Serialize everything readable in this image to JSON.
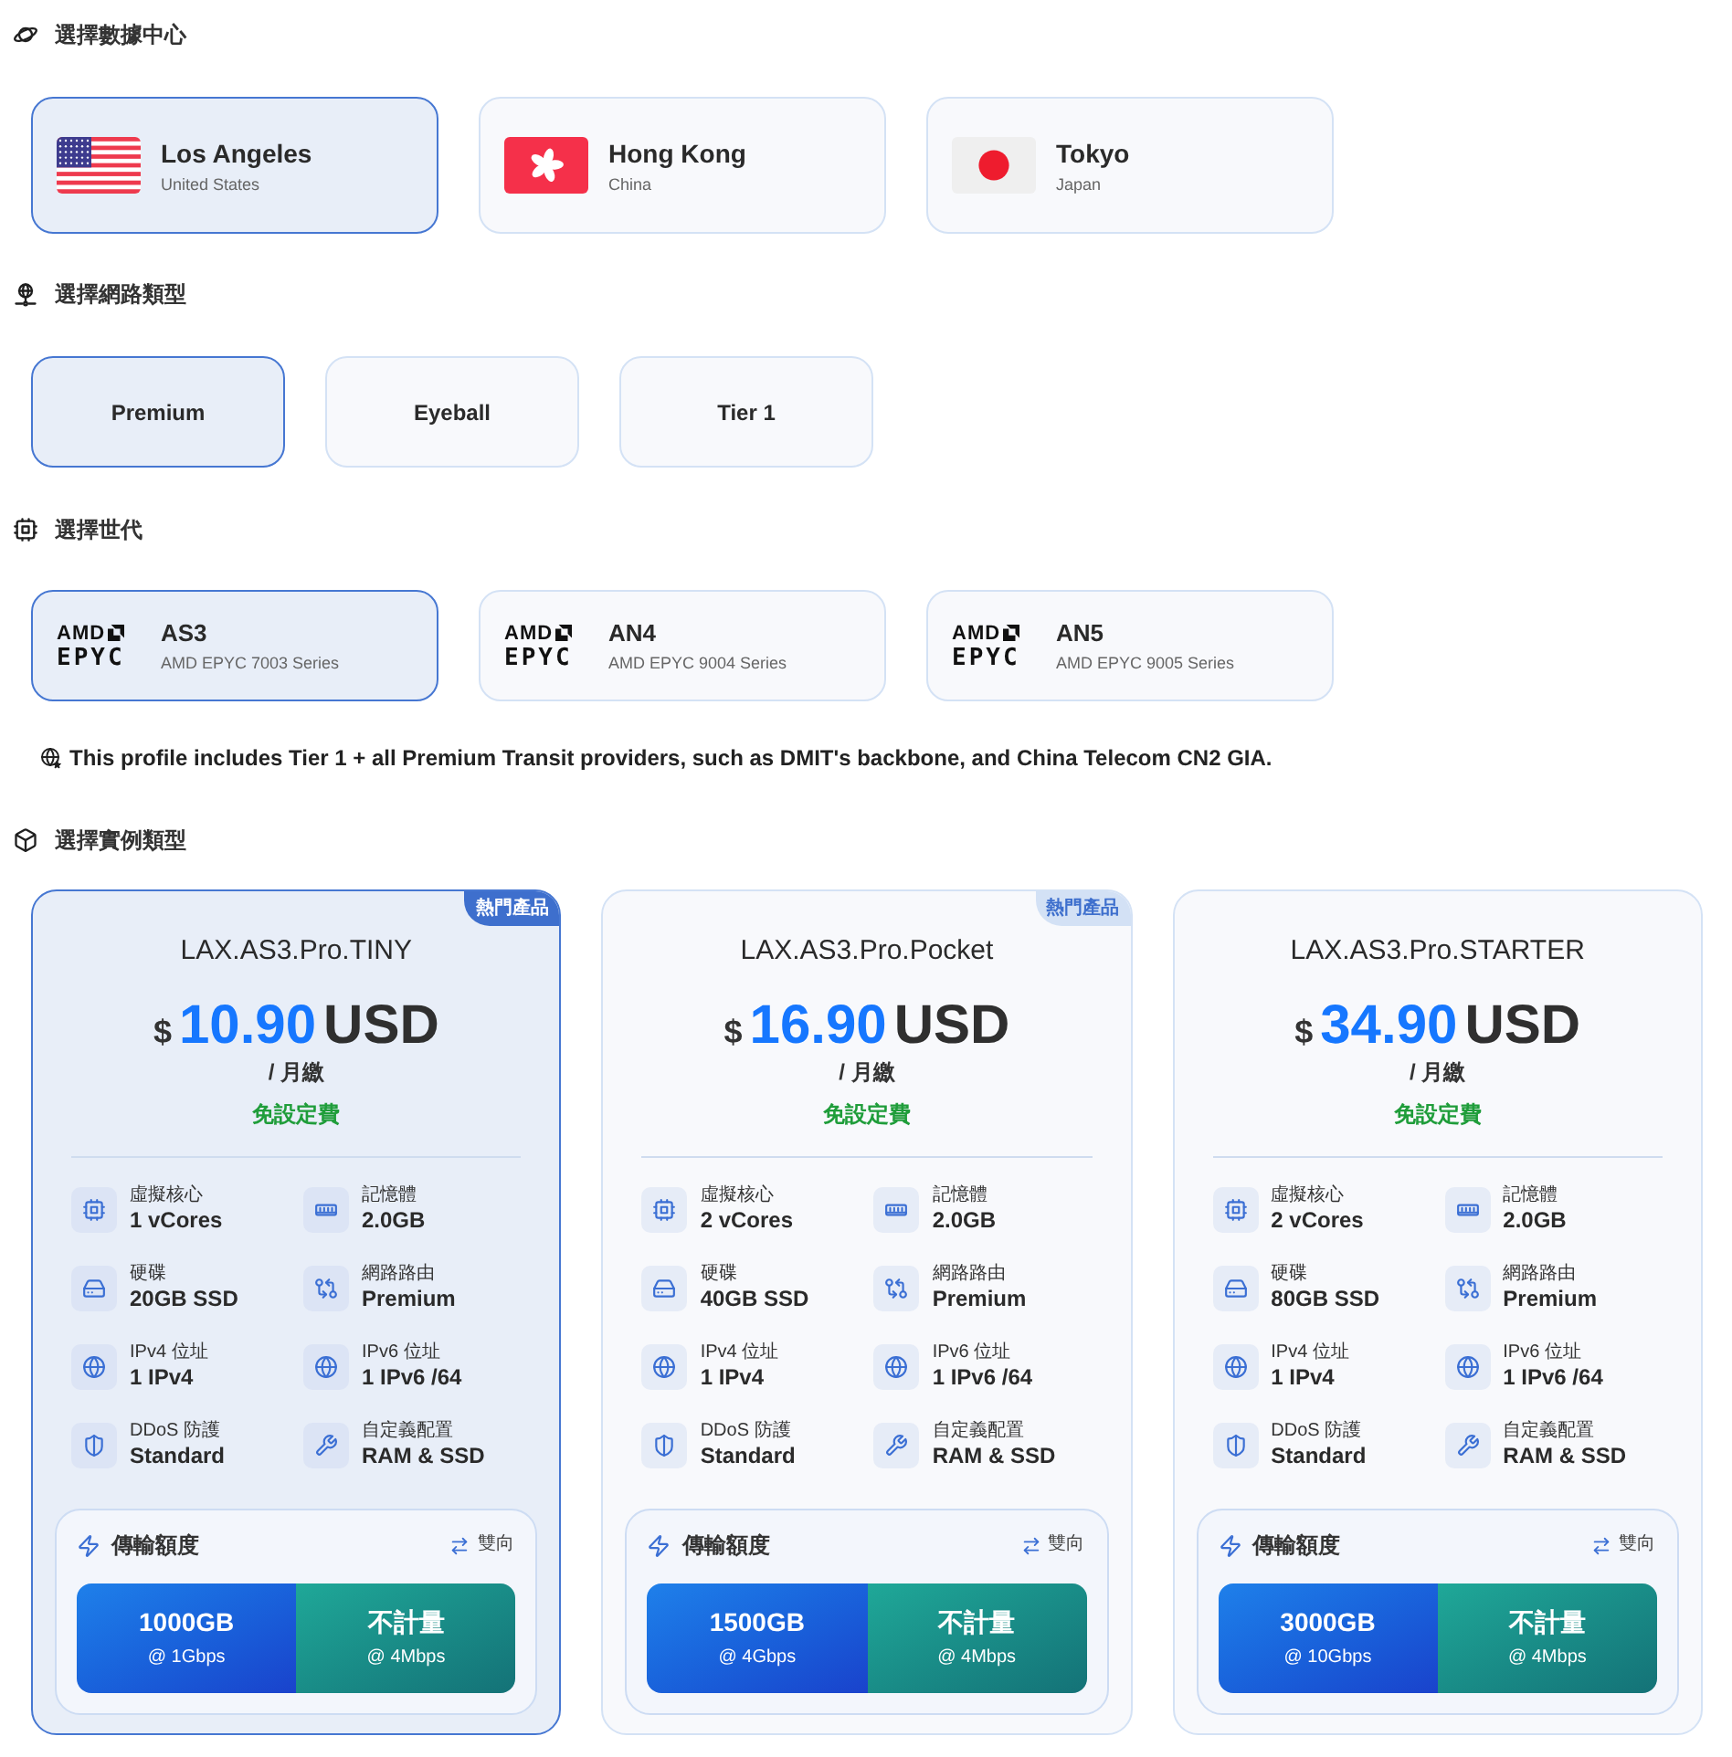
{
  "datacenter_section": {
    "title": "選擇數據中心",
    "options": [
      {
        "kind": "us",
        "city": "Los Angeles",
        "country": "United States",
        "selected": true
      },
      {
        "kind": "hk",
        "city": "Hong Kong",
        "country": "China",
        "selected": false
      },
      {
        "kind": "jp",
        "city": "Tokyo",
        "country": "Japan",
        "selected": false
      }
    ]
  },
  "network_section": {
    "title": "選擇網路類型",
    "options": [
      {
        "label": "Premium",
        "selected": true
      },
      {
        "label": "Eyeball",
        "selected": false
      },
      {
        "label": "Tier 1",
        "selected": false
      }
    ]
  },
  "generation_section": {
    "title": "選擇世代",
    "options": [
      {
        "logo_top": "AMD",
        "logo_bottom": "EPYC",
        "name": "AS3",
        "series": "AMD EPYC 7003 Series",
        "selected": true
      },
      {
        "logo_top": "AMD",
        "logo_bottom": "EPYC",
        "name": "AN4",
        "series": "AMD EPYC 9004 Series",
        "selected": false
      },
      {
        "logo_top": "AMD",
        "logo_bottom": "EPYC",
        "name": "AN5",
        "series": "AMD EPYC 9005 Series",
        "selected": false
      }
    ]
  },
  "note": "This profile includes Tier 1 + all Premium Transit providers, such as DMIT's backbone, and China Telecom CN2 GIA.",
  "instance_section": {
    "title": "選擇實例類型",
    "plans": [
      {
        "badge": "熱門產品",
        "name": "LAX.AS3.Pro.TINY",
        "currency_symbol": "$",
        "price": "10.90",
        "currency": "USD",
        "period": "/ 月繳",
        "setup": "免設定費",
        "selected": true,
        "specs": [
          {
            "kind": "cpu",
            "label": "虛擬核心",
            "value": "1 vCores"
          },
          {
            "kind": "memory",
            "label": "記憶體",
            "value": "2.0GB"
          },
          {
            "kind": "disk",
            "label": "硬碟",
            "value": "20GB SSD"
          },
          {
            "kind": "route",
            "label": "網路路由",
            "value": "Premium"
          },
          {
            "kind": "globe",
            "label": "IPv4 位址",
            "value": "1 IPv4"
          },
          {
            "kind": "globe",
            "label": "IPv6 位址",
            "value": "1 IPv6 /64"
          },
          {
            "kind": "shield",
            "label": "DDoS 防護",
            "value": "Standard"
          },
          {
            "kind": "wrench",
            "label": "自定義配置",
            "value": "RAM & SSD"
          }
        ],
        "transfer": {
          "title": "傳輸額度",
          "direction": "雙向",
          "quota": "1000GB",
          "quota_speed": "@ 1Gbps",
          "overflow": "不計量",
          "overflow_speed": "@ 4Mbps"
        }
      },
      {
        "badge": "熱門產品",
        "name": "LAX.AS3.Pro.Pocket",
        "currency_symbol": "$",
        "price": "16.90",
        "currency": "USD",
        "period": "/ 月繳",
        "setup": "免設定費",
        "selected": false,
        "specs": [
          {
            "kind": "cpu",
            "label": "虛擬核心",
            "value": "2 vCores"
          },
          {
            "kind": "memory",
            "label": "記憶體",
            "value": "2.0GB"
          },
          {
            "kind": "disk",
            "label": "硬碟",
            "value": "40GB SSD"
          },
          {
            "kind": "route",
            "label": "網路路由",
            "value": "Premium"
          },
          {
            "kind": "globe",
            "label": "IPv4 位址",
            "value": "1 IPv4"
          },
          {
            "kind": "globe",
            "label": "IPv6 位址",
            "value": "1 IPv6 /64"
          },
          {
            "kind": "shield",
            "label": "DDoS 防護",
            "value": "Standard"
          },
          {
            "kind": "wrench",
            "label": "自定義配置",
            "value": "RAM & SSD"
          }
        ],
        "transfer": {
          "title": "傳輸額度",
          "direction": "雙向",
          "quota": "1500GB",
          "quota_speed": "@ 4Gbps",
          "overflow": "不計量",
          "overflow_speed": "@ 4Mbps"
        }
      },
      {
        "name": "LAX.AS3.Pro.STARTER",
        "currency_symbol": "$",
        "price": "34.90",
        "currency": "USD",
        "period": "/ 月繳",
        "setup": "免設定費",
        "selected": false,
        "specs": [
          {
            "kind": "cpu",
            "label": "虛擬核心",
            "value": "2 vCores"
          },
          {
            "kind": "memory",
            "label": "記憶體",
            "value": "2.0GB"
          },
          {
            "kind": "disk",
            "label": "硬碟",
            "value": "80GB SSD"
          },
          {
            "kind": "route",
            "label": "網路路由",
            "value": "Premium"
          },
          {
            "kind": "globe",
            "label": "IPv4 位址",
            "value": "1 IPv4"
          },
          {
            "kind": "globe",
            "label": "IPv6 位址",
            "value": "1 IPv6 /64"
          },
          {
            "kind": "shield",
            "label": "DDoS 防護",
            "value": "Standard"
          },
          {
            "kind": "wrench",
            "label": "自定義配置",
            "value": "RAM & SSD"
          }
        ],
        "transfer": {
          "title": "傳輸額度",
          "direction": "雙向",
          "quota": "3000GB",
          "quota_speed": "@ 10Gbps",
          "overflow": "不計量",
          "overflow_speed": "@ 4Mbps"
        }
      }
    ]
  }
}
